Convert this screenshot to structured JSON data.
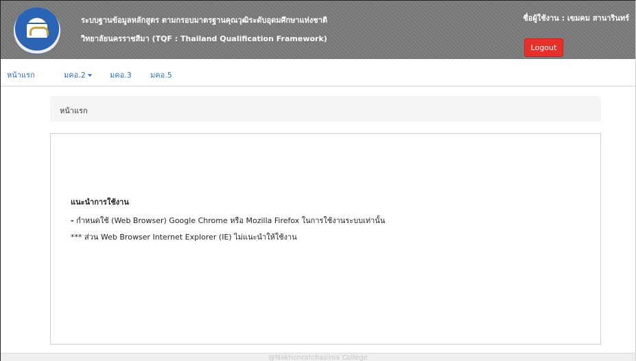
{
  "header": {
    "title_line1": "ระบบฐานข้อมูลหลักสูตร ตามกรอบมาตรฐานคุณวุฒิระดับอุดมศึกษาแห่งชาติ",
    "title_line2": "วิทยาลัยนครราชสีมา (TQF : Thailand Qualification Framework)",
    "user_label": "ชื่อผู้ใช้งาน : เขมคม สานารินทร์",
    "logout_label": "Logout",
    "logout_color": "#e8302b",
    "header_color": "#7b7b7b",
    "logo_icon": "college-seal-logo"
  },
  "nav": {
    "items": [
      {
        "label": "หน้าแรก"
      },
      {
        "label": "มคอ.2",
        "has_dropdown": true
      },
      {
        "label": "มคอ.3"
      },
      {
        "label": "มคอ.5"
      }
    ],
    "link_color": "#2a6fc9"
  },
  "breadcrumb": {
    "current": "หน้าแรก"
  },
  "guide": {
    "title": "แนะนำการใช้งาน",
    "line1_prefix": "-",
    "line1": "กำหนดใช้ (Web Browser) Google Chrome หรือ Mozilla Firefox ในการใช้งานระบบเท่านั้น",
    "line2": "*** ส่วน Web Browser Internet Explorer (IE) ไม่แนะนำให้ใช้งาน"
  },
  "footer": {
    "text": "@Nakhonratchasima College"
  }
}
